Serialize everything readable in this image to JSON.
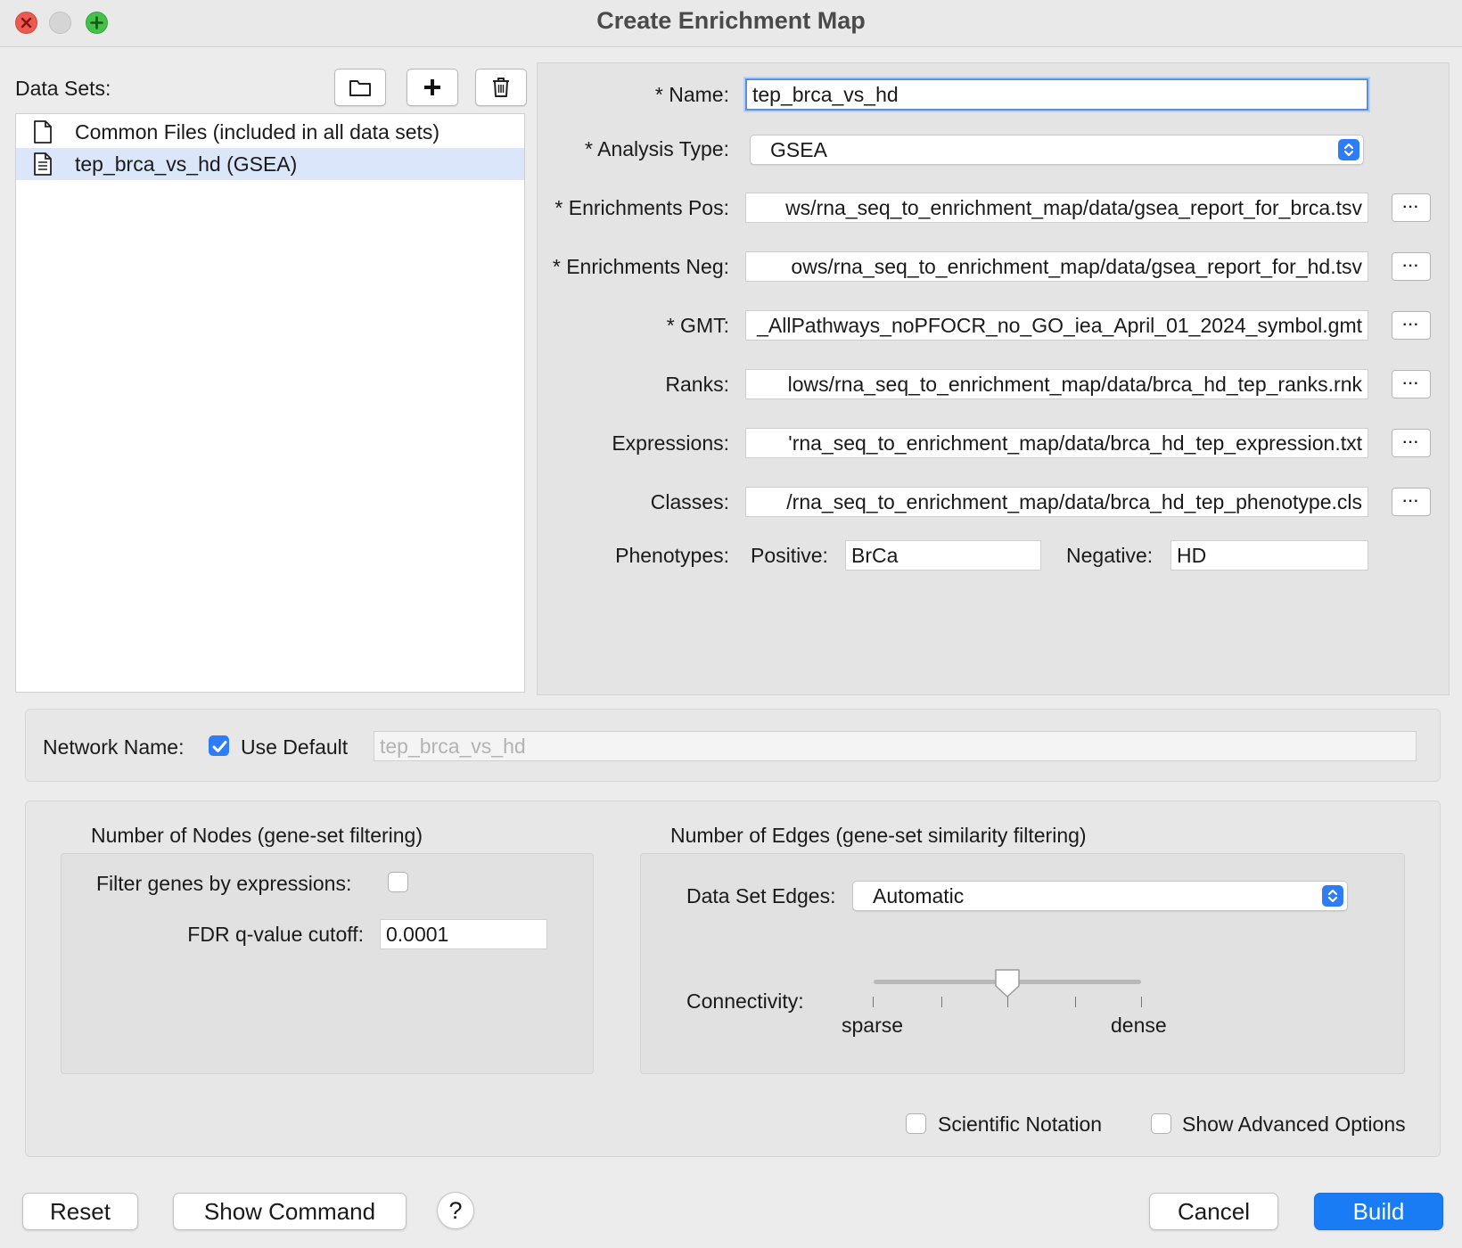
{
  "window": {
    "title": "Create Enrichment Map"
  },
  "datasets": {
    "label": "Data Sets:",
    "items": [
      {
        "label": "Common Files (included in all data sets)"
      },
      {
        "label": "tep_brca_vs_hd  (GSEA)"
      }
    ]
  },
  "form": {
    "name_label": "* Name:",
    "name_value": "tep_brca_vs_hd",
    "analysis_label": "* Analysis Type:",
    "analysis_value": "GSEA",
    "pos_label": "* Enrichments Pos:",
    "pos_value": "ws/rna_seq_to_enrichment_map/data/gsea_report_for_brca.tsv",
    "neg_label": "* Enrichments Neg:",
    "neg_value": "ows/rna_seq_to_enrichment_map/data/gsea_report_for_hd.tsv",
    "gmt_label": "* GMT:",
    "gmt_value": "_AllPathways_noPFOCR_no_GO_iea_April_01_2024_symbol.gmt",
    "ranks_label": "Ranks:",
    "ranks_value": "lows/rna_seq_to_enrichment_map/data/brca_hd_tep_ranks.rnk",
    "expr_label": "Expressions:",
    "expr_value": "'rna_seq_to_enrichment_map/data/brca_hd_tep_expression.txt",
    "classes_label": "Classes:",
    "classes_value": "/rna_seq_to_enrichment_map/data/brca_hd_tep_phenotype.cls",
    "phenotypes_label": "Phenotypes:",
    "positive_label": "Positive:",
    "positive_value": "BrCa",
    "negative_label": "Negative:",
    "negative_value": "HD",
    "browse_label": "···"
  },
  "network": {
    "label": "Network Name:",
    "use_default_label": "Use Default",
    "use_default_checked": true,
    "name_placeholder": "tep_brca_vs_hd"
  },
  "nodes": {
    "title": "Number of Nodes (gene-set filtering)",
    "filter_label": "Filter genes by expressions:",
    "filter_checked": false,
    "fdr_label": "FDR q-value cutoff:",
    "fdr_value": "0.0001"
  },
  "edges": {
    "title": "Number of Edges (gene-set similarity filtering)",
    "dataset_edges_label": "Data Set Edges:",
    "dataset_edges_value": "Automatic",
    "connectivity_label": "Connectivity:",
    "sparse_label": "sparse",
    "dense_label": "dense",
    "connectivity_position": 0.5
  },
  "options": {
    "scientific_label": "Scientific Notation",
    "advanced_label": "Show Advanced Options"
  },
  "buttons": {
    "reset": "Reset",
    "show_command": "Show Command",
    "help": "?",
    "cancel": "Cancel",
    "build": "Build"
  },
  "colors": {
    "accent": "#1a7cf5",
    "selection": "#dbe6fb"
  }
}
